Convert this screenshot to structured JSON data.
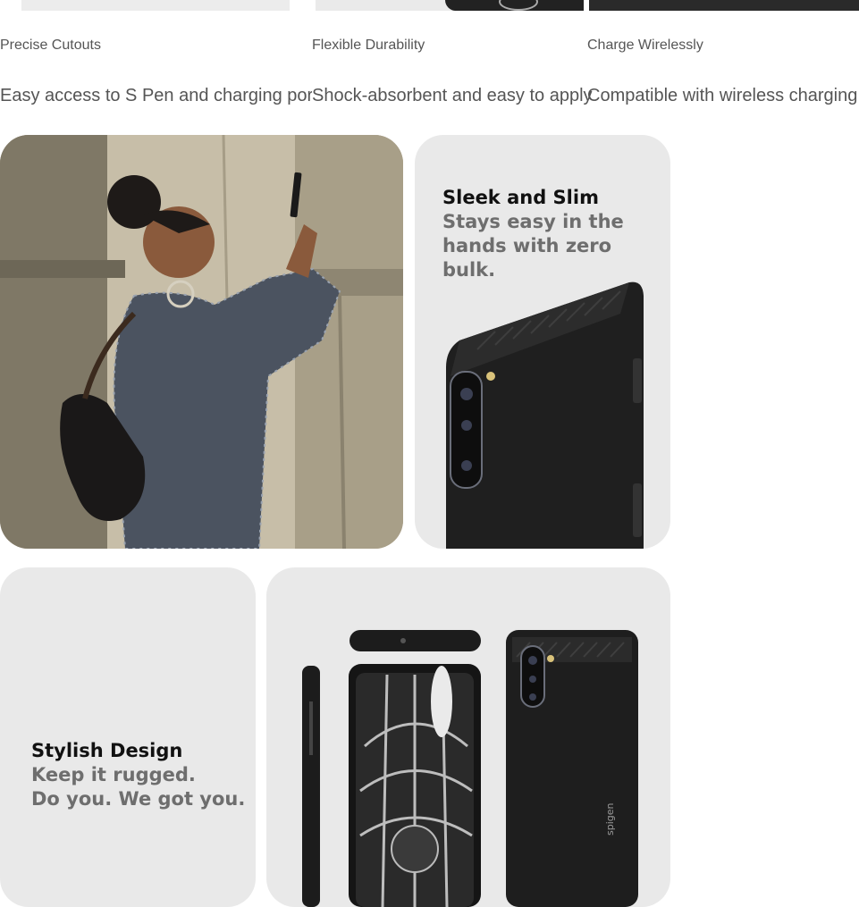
{
  "features": [
    {
      "title": "Precise Cutouts",
      "description": "Easy access to S Pen and charging port"
    },
    {
      "title": "Flexible Durability",
      "description": "Shock-absorbent and easy to apply"
    },
    {
      "title": "Charge Wirelessly",
      "description": "Compatible with wireless charging"
    }
  ],
  "sleek": {
    "title": "Sleek and Slim",
    "line1": "Stays easy in the",
    "line2": "hands with zero bulk."
  },
  "stylish": {
    "title": "Stylish Design",
    "line1": "Keep it rugged.",
    "line2": "Do you. We got you."
  },
  "colors": {
    "card_bg": "#e9e9e9",
    "text_gray": "#555555",
    "case_black": "#1c1c1c"
  }
}
